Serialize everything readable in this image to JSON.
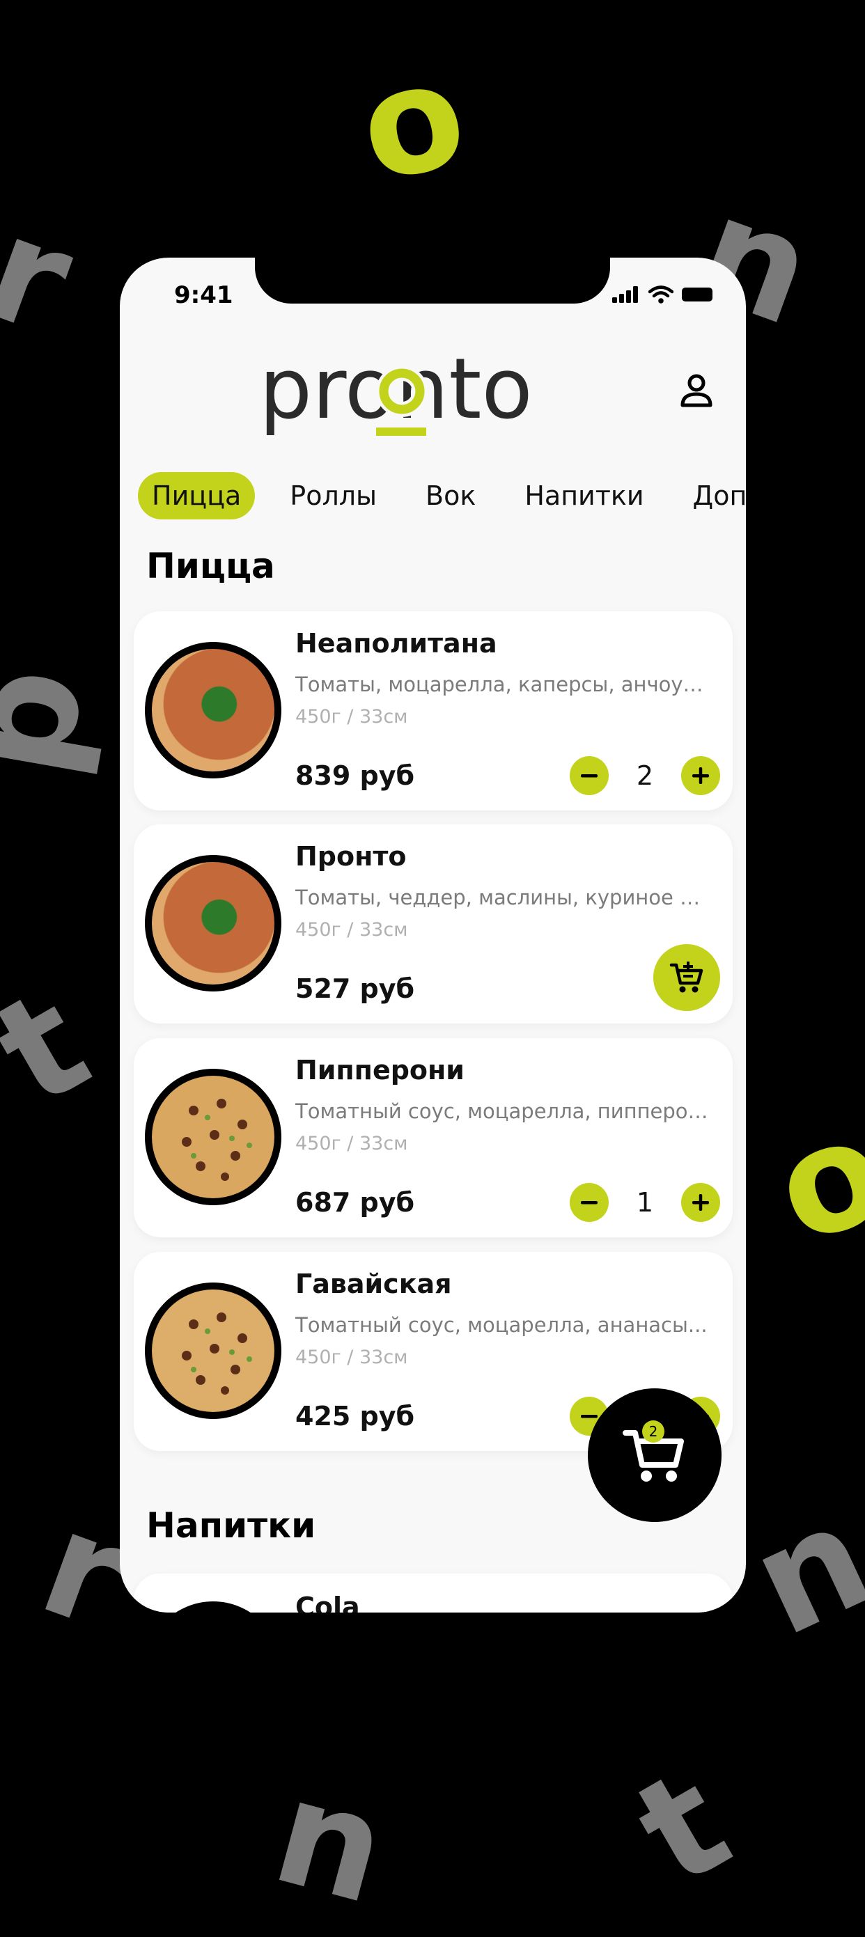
{
  "background_letters": {
    "top_o": "o",
    "left_r": "r",
    "right_n": "n",
    "left_p": "p",
    "left_t": "t",
    "right_o": "o",
    "bottom_left_r": "r",
    "bottom_right_n": "n",
    "bottom_n": "n",
    "bottom_t": "t"
  },
  "colors": {
    "accent": "#c3d21a",
    "background": "#000000",
    "screen": "#f8f8f8",
    "card": "#ffffff"
  },
  "status_bar": {
    "time": "9:41"
  },
  "header": {
    "logo_text": "pronto"
  },
  "tabs": [
    {
      "label": "Пицца",
      "active": true
    },
    {
      "label": "Роллы",
      "active": false
    },
    {
      "label": "Вок",
      "active": false
    },
    {
      "label": "Напитки",
      "active": false
    },
    {
      "label": "Допол",
      "active": false
    }
  ],
  "sections": {
    "pizza_title": "Пицца",
    "drinks_title": "Напитки"
  },
  "products": [
    {
      "name": "Неаполитана",
      "description": "Томаты, моцарелла, каперсы, анчоусы...",
      "weight": "450г / 33см",
      "price": "839 руб",
      "quantity": "2"
    },
    {
      "name": "Пронто",
      "description": "Томаты, чеддер, маслины, куриное филе,...",
      "weight": "450г / 33см",
      "price": "527 руб",
      "quantity": null
    },
    {
      "name": "Пипперони",
      "description": "Томатный соус, моцарелла, пипперони",
      "weight": "450г / 33см",
      "price": "687 руб",
      "quantity": "1"
    },
    {
      "name": "Гавайская",
      "description": "Томатный соус, моцарелла, ананасы...",
      "weight": "450г / 33см",
      "price": "425 руб",
      "quantity": null
    }
  ],
  "drinks": [
    {
      "name": "Cola"
    }
  ],
  "cart": {
    "count": "2"
  },
  "icons": {
    "user": "user-icon",
    "minus": "minus-icon",
    "plus": "plus-icon",
    "add_to_cart": "cart-plus-icon",
    "cart": "cart-icon"
  }
}
